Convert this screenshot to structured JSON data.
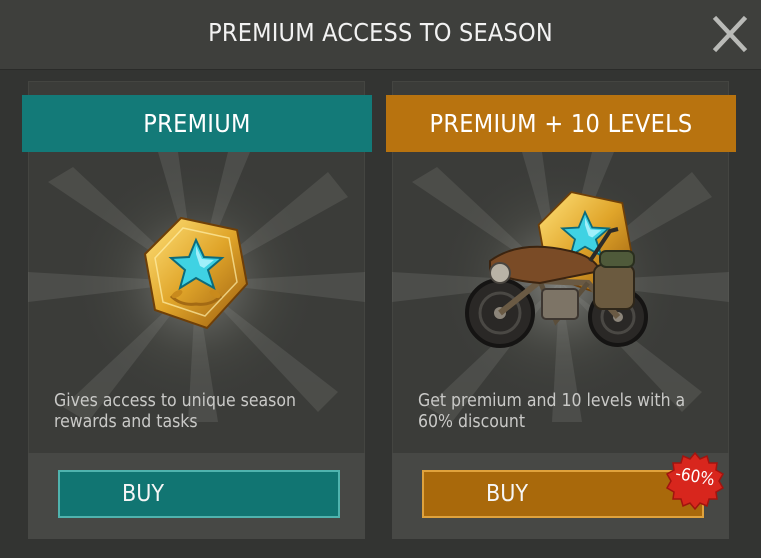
{
  "header": {
    "title": "PREMIUM ACCESS TO SEASON"
  },
  "cards": [
    {
      "title": "PREMIUM",
      "description": "Gives access to unique season rewards and tasks",
      "buy_label": "BUY",
      "accent": "#137a78"
    },
    {
      "title": "PREMIUM + 10 LEVELS",
      "description": "Get premium and 10 levels with a 60% discount",
      "buy_label": "BUY",
      "accent": "#b8730f",
      "discount": "-60%"
    }
  ],
  "icons": [
    "close-icon",
    "star-badge-icon",
    "motorcycle-icon",
    "discount-badge"
  ]
}
